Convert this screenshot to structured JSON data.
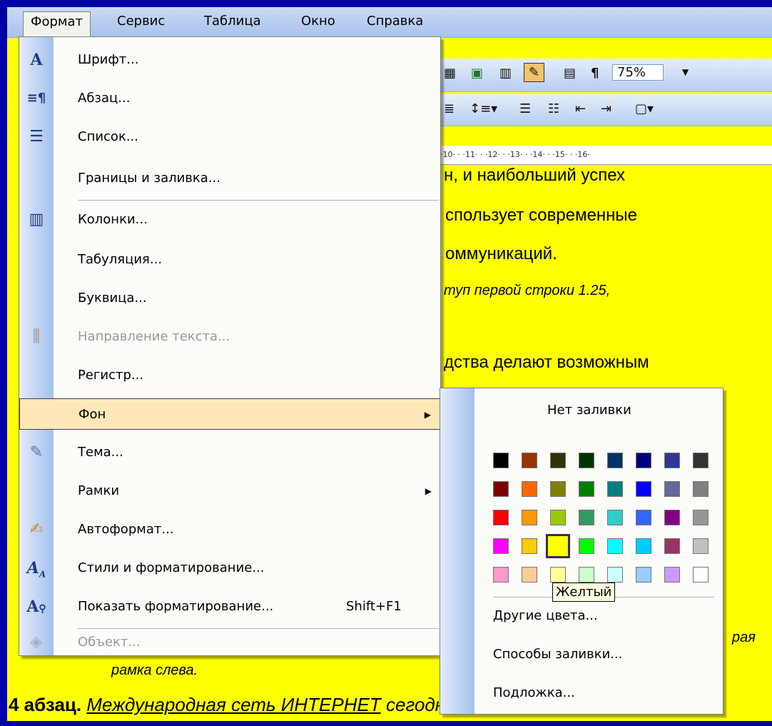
{
  "menubar": {
    "items": [
      {
        "label": "Формат",
        "active": true
      },
      {
        "label": "Сервис"
      },
      {
        "label": "Таблица"
      },
      {
        "label": "Окно"
      },
      {
        "label": "Справка"
      }
    ]
  },
  "toolbar": {
    "zoom": "75%",
    "pilcrow": "¶",
    "ruler": "· ·10· · ·11· · ·12· · ·13· · ·14· · ·15· · ·16·"
  },
  "document": {
    "line1": "н, и наибольший успех",
    "line2": "спользует современные",
    "line3": "оммуникаций.",
    "line4": "туп первой строки 1.25,",
    "line5": "дства делают возможным",
    "line6": "рая",
    "line7": "рамка слева.",
    "para4_bold": "4 абзац.",
    "para4_link": "Международная сеть ИНТЕРНЕТ",
    "para4_rest": "сегодня является одним из"
  },
  "format_menu": {
    "items": [
      {
        "label": "Шрифт...",
        "icon": "font-icon"
      },
      {
        "label": "Абзац...",
        "icon": "paragraph-icon"
      },
      {
        "label": "Список...",
        "icon": "list-icon"
      },
      {
        "label": "Границы и заливка..."
      },
      {
        "label": "Колонки...",
        "icon": "columns-icon"
      },
      {
        "label": "Табуляция..."
      },
      {
        "label": "Буквица..."
      },
      {
        "label": "Направление текста...",
        "icon": "text-direction-icon",
        "disabled": true
      },
      {
        "label": "Регистр..."
      },
      {
        "label": "Фон",
        "submenu": true,
        "highlighted": true
      },
      {
        "label": "Тема...",
        "icon": "theme-icon"
      },
      {
        "label": "Рамки",
        "submenu": true
      },
      {
        "label": "Автоформат...",
        "icon": "autoformat-icon"
      },
      {
        "label": "Стили и форматирование...",
        "icon": "styles-icon"
      },
      {
        "label": "Показать форматирование...",
        "icon": "reveal-formatting-icon",
        "shortcut": "Shift+F1"
      },
      {
        "label": "Объект...",
        "icon": "object-icon",
        "disabled": true
      }
    ]
  },
  "background_submenu": {
    "no_fill": "Нет заливки",
    "palette": [
      [
        "#000000",
        "#993300",
        "#333300",
        "#003300",
        "#003366",
        "#000080",
        "#333399",
        "#333333"
      ],
      [
        "#800000",
        "#FF6600",
        "#808000",
        "#008000",
        "#008080",
        "#0000FF",
        "#666699",
        "#808080"
      ],
      [
        "#FF0000",
        "#FF9900",
        "#99CC00",
        "#339966",
        "#33CCCC",
        "#3366FF",
        "#800080",
        "#969696"
      ],
      [
        "#FF00FF",
        "#FFCC00",
        "#FFFF00",
        "#00FF00",
        "#00FFFF",
        "#00CCFF",
        "#993366",
        "#C0C0C0"
      ],
      [
        "#FF99CC",
        "#FFCC99",
        "#FFFF99",
        "#CCFFCC",
        "#CCFFFF",
        "#99CCFF",
        "#CC99FF",
        "#FFFFFF"
      ]
    ],
    "selected": "#FFFF00",
    "tooltip": "Желтый",
    "more_colors": "Другие цвета...",
    "fill_effects": "Способы заливки...",
    "watermark": "Подложка..."
  }
}
